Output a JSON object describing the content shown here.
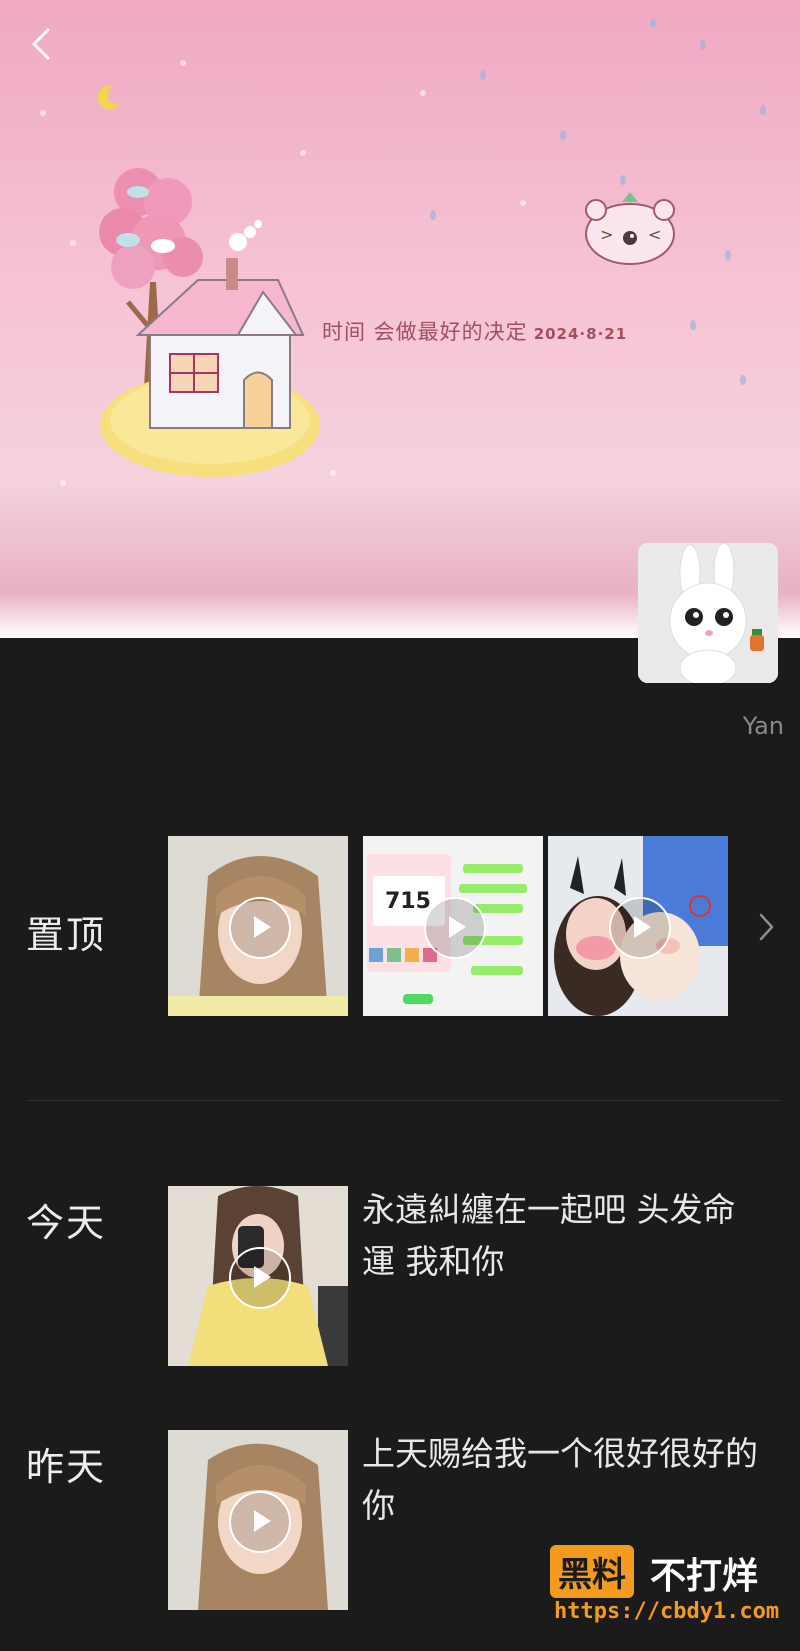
{
  "cover": {
    "caption": "时间 会做最好的决定",
    "date": "2024·8·21"
  },
  "profile": {
    "username": "Yan"
  },
  "sections": {
    "pinned": {
      "label": "置顶"
    },
    "today": {
      "label": "今天",
      "post_text": "永遠糾纏在一起吧 头发命運 我和你"
    },
    "yesterday": {
      "label": "昨天",
      "post_text": "上天赐给我一个很好很好的你"
    }
  },
  "pinned_thumbs": [
    {
      "kind": "selfie"
    },
    {
      "kind": "chat-screenshot",
      "number": "715"
    },
    {
      "kind": "pet-photo"
    }
  ],
  "watermark": {
    "badge": "黑料",
    "title": "不打烊",
    "url": "https://cbdy1.com"
  },
  "colors": {
    "background": "#1b1b1b",
    "cover_pink": "#f6c3d5",
    "accent_orange": "#f29b1e"
  }
}
